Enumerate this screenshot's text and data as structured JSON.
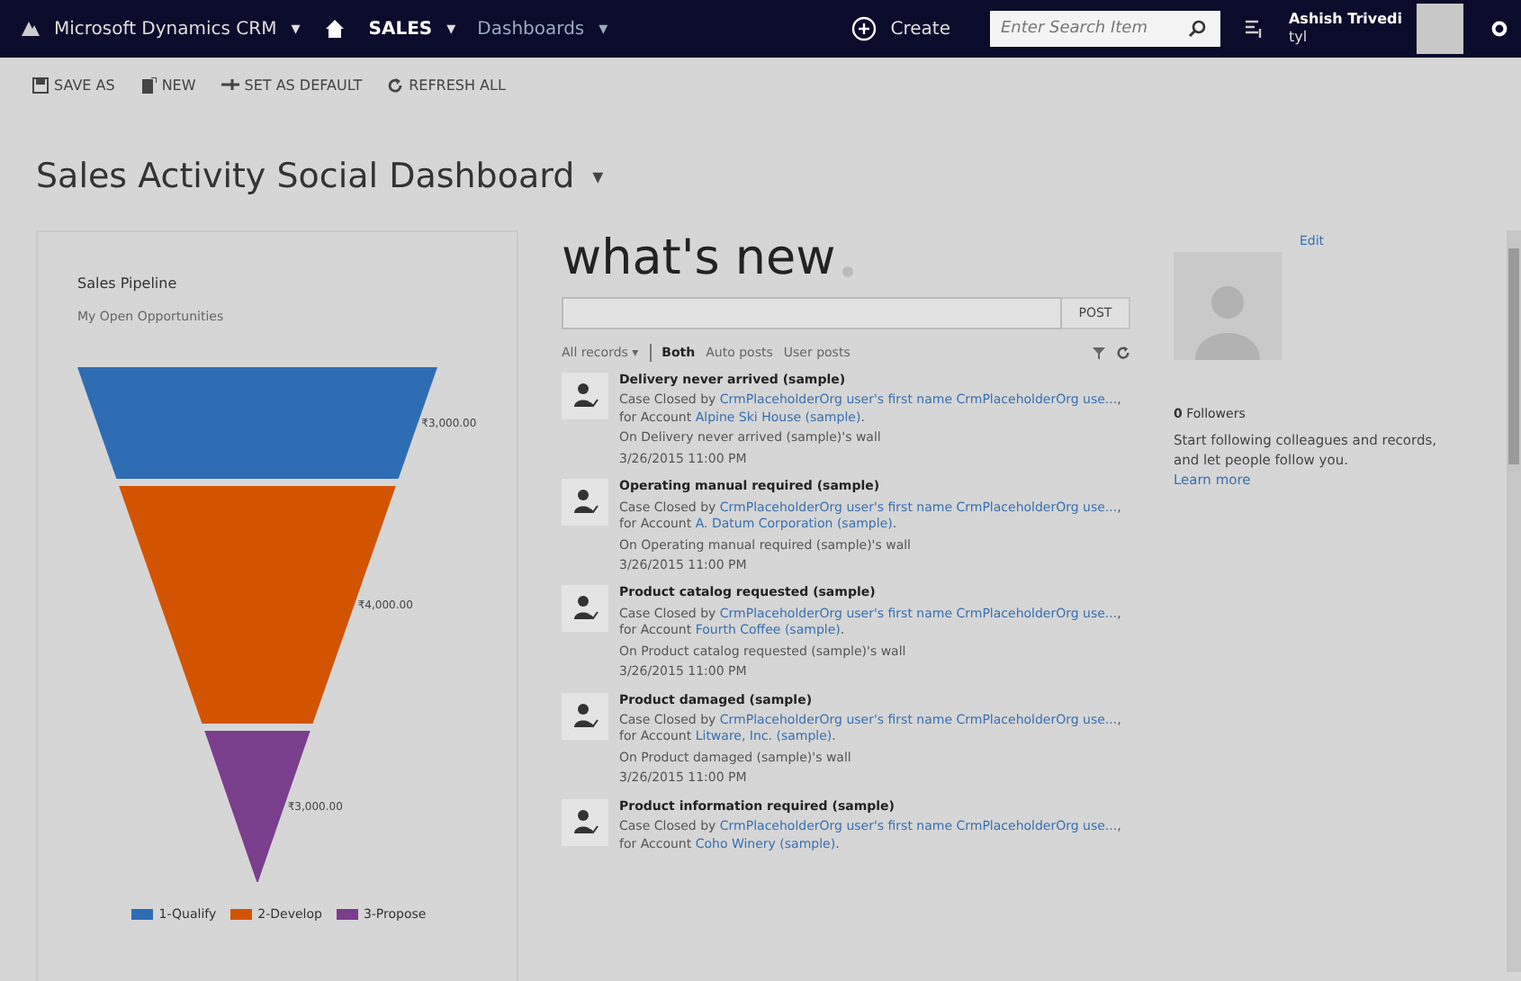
{
  "nav_bar": {
    "app_name": "Microsoft Dynamics CRM",
    "app_caret": "▾",
    "area": "SALES",
    "area_caret": "▾",
    "page": "Dashboards",
    "page_caret": "▾",
    "create": "Create",
    "search": {
      "placeholder": "Enter Search Item"
    },
    "user": {
      "name": "Ashish Trivedi",
      "org": "tyl"
    }
  },
  "toolbar": [
    {
      "kind": "save",
      "label": "SAVE AS"
    },
    {
      "kind": "new",
      "label": "NEW"
    },
    {
      "kind": "default",
      "label": "SET AS DEFAULT"
    },
    {
      "kind": "refresh",
      "label": "REFRESH ALL"
    }
  ],
  "dashboard": {
    "title": "Sales Activity Social Dashboard",
    "caret": "▾"
  },
  "chart_card": {
    "title": "Sales Pipeline",
    "subtitle": "My Open Opportunities",
    "funnel": [
      {
        "label": "1-Qualify",
        "value_label": "₹3,000.00",
        "color": "#2e6db4"
      },
      {
        "label": "2-Develop",
        "value_label": "₹4,000.00",
        "color": "#d35400"
      },
      {
        "label": "3-Propose",
        "value_label": "₹3,000.00",
        "color": "#7a3f8c"
      }
    ]
  },
  "whats_new": {
    "title": "what's new",
    "post_button": "POST",
    "filters": [
      {
        "label": "All records ▾",
        "kind": "dropdown",
        "selected": false
      },
      {
        "label": "Both",
        "kind": "tab",
        "selected": true
      },
      {
        "label": "Auto posts",
        "kind": "tab",
        "selected": false
      },
      {
        "label": "User posts",
        "kind": "tab",
        "selected": false
      }
    ],
    "posts": [
      {
        "title": "Delivery never arrived (sample)",
        "prefix": "Case Closed by ",
        "user_link": "CrmPlaceholderOrg user's first name CrmPlaceholderOrg use...",
        "middle": ", for Account ",
        "account_link": "Alpine Ski House (sample)",
        "suffix": ".",
        "wall": "On Delivery never arrived (sample)'s wall",
        "time": "3/26/2015 11:00 PM"
      },
      {
        "title": "Operating manual required (sample)",
        "prefix": "Case Closed by ",
        "user_link": "CrmPlaceholderOrg user's first name CrmPlaceholderOrg use...",
        "middle": ", for Account ",
        "account_link": "A. Datum Corporation (sample)",
        "suffix": ".",
        "wall": "On Operating manual required (sample)'s wall",
        "time": "3/26/2015 11:00 PM"
      },
      {
        "title": "Product catalog requested (sample)",
        "prefix": "Case Closed by ",
        "user_link": "CrmPlaceholderOrg user's first name CrmPlaceholderOrg use...",
        "middle": ", for Account ",
        "account_link": "Fourth Coffee (sample)",
        "suffix": ".",
        "wall": "On Product catalog requested (sample)'s wall",
        "time": "3/26/2015 11:00 PM"
      },
      {
        "title": "Product damaged (sample)",
        "prefix": "Case Closed by ",
        "user_link": "CrmPlaceholderOrg user's first name CrmPlaceholderOrg use...",
        "middle": ", for Account ",
        "account_link": "Litware, Inc. (sample)",
        "suffix": ".",
        "wall": "On Product damaged (sample)'s wall",
        "time": "3/26/2015 11:00 PM"
      },
      {
        "title": "Product information required (sample)",
        "prefix": "Case Closed by ",
        "user_link": "CrmPlaceholderOrg user's first name CrmPlaceholderOrg use...",
        "middle": ", for Account ",
        "account_link": "Coho Winery (sample)",
        "suffix": "."
      }
    ]
  },
  "profile": {
    "edit": "Edit",
    "followers": "**0** Followers",
    "message": "Start following colleagues and records, and let people follow you.",
    "learn_more": "Learn more"
  }
}
